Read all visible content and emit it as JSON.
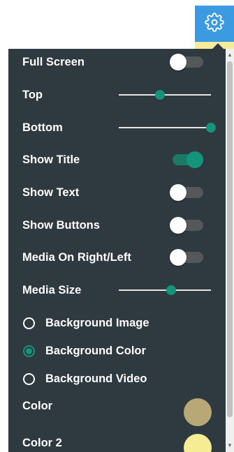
{
  "header": {
    "settings_icon": "gear-icon"
  },
  "settings": {
    "full_screen": {
      "label": "Full Screen",
      "on": false
    },
    "top": {
      "label": "Top",
      "value": 0.45
    },
    "bottom": {
      "label": "Bottom",
      "value": 1.0
    },
    "show_title": {
      "label": "Show Title",
      "on": true
    },
    "show_text": {
      "label": "Show Text",
      "on": false
    },
    "show_buttons": {
      "label": "Show Buttons",
      "on": false
    },
    "media_side": {
      "label": "Media On Right/Left",
      "on": false
    },
    "media_size": {
      "label": "Media Size",
      "value": 0.57
    },
    "background": {
      "options": [
        {
          "label": "Background Image",
          "checked": false
        },
        {
          "label": "Background Color",
          "checked": true
        },
        {
          "label": "Background Video",
          "checked": false
        }
      ]
    },
    "color": {
      "label": "Color",
      "value": "#b9a877"
    },
    "color2": {
      "label": "Color 2",
      "value": "#f5ec93"
    }
  },
  "colors": {
    "accent": "#16937b",
    "panel_bg": "#2e3a40",
    "header_button": "#3b9ae0"
  }
}
